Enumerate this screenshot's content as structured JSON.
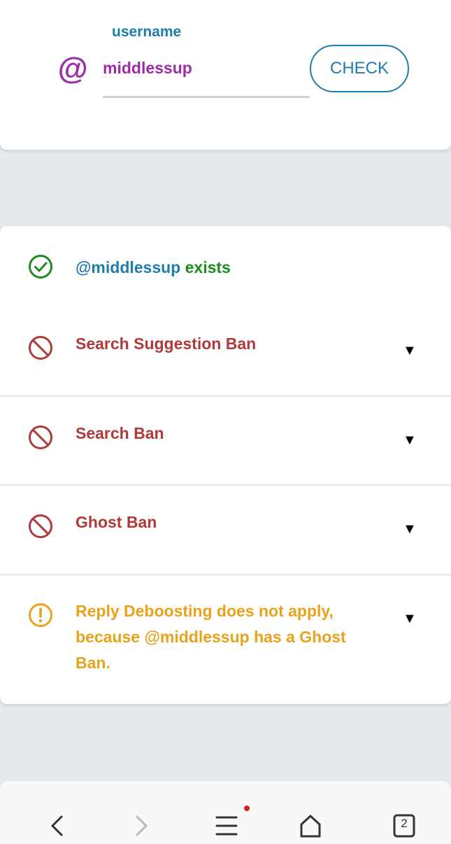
{
  "search": {
    "at_symbol": "@",
    "label": "username",
    "value": "middlessup",
    "check_label": "CHECK"
  },
  "results": {
    "exists": {
      "handle": "@middlessup",
      "suffix": " exists"
    },
    "items": [
      {
        "label": "Search Suggestion Ban",
        "status": "banned"
      },
      {
        "label": "Search Ban",
        "status": "banned"
      },
      {
        "label": "Ghost Ban",
        "status": "banned"
      },
      {
        "label": "Reply Deboosting does not apply, because @middlessup has a Ghost Ban.",
        "status": "warning"
      }
    ],
    "caret": "▼"
  },
  "nav": {
    "tab_count": "2",
    "menu_has_notification": true
  },
  "colors": {
    "accent_blue": "#1e7dad",
    "purple": "#9c2ca8",
    "ok_green": "#1e8a1e",
    "ban_red": "#b03a3a",
    "warn_amber": "#e9a21b"
  }
}
